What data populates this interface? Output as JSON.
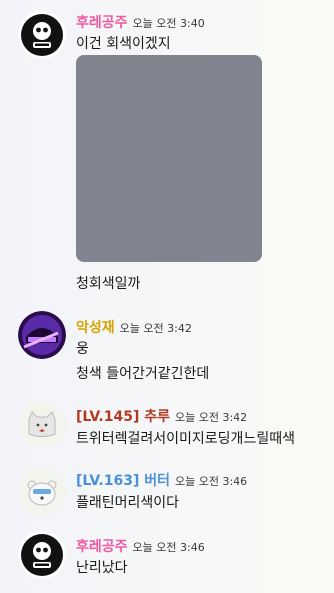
{
  "colors": {
    "pink_user": "#f05aa0",
    "gold_user": "#d9a400",
    "maroon_user": "#b23a22",
    "blue_user": "#4a90d9",
    "attachment_gray": "#80848e"
  },
  "messages": [
    {
      "username": "후레공주",
      "timestamp": "오늘 오전 3:40",
      "avatar_icon": "black-emblem-avatar-icon",
      "lines": [
        "이건 회색이겠지"
      ],
      "has_attachment": true,
      "after_attachment": "청회색일까"
    },
    {
      "username": "악성재",
      "timestamp": "오늘 오전 3:42",
      "avatar_icon": "purple-helmet-avatar-icon",
      "lines": [
        "웅",
        "청색 들어간거같긴한데"
      ]
    },
    {
      "username": "[LV.145] 추루",
      "timestamp": "오늘 오전 3:42",
      "avatar_icon": "gray-cat-avatar-icon",
      "lines": [
        "트위터렉걸려서이미지로딩개느릴때색"
      ]
    },
    {
      "username": "[LV.163] 버터",
      "timestamp": "오늘 오전 3:46",
      "avatar_icon": "white-bear-avatar-icon",
      "lines": [
        "플래틴머리색이다"
      ]
    },
    {
      "username": "후레공주",
      "timestamp": "오늘 오전 3:46",
      "avatar_icon": "black-emblem-avatar-icon",
      "lines": [
        "난리났다"
      ]
    }
  ]
}
